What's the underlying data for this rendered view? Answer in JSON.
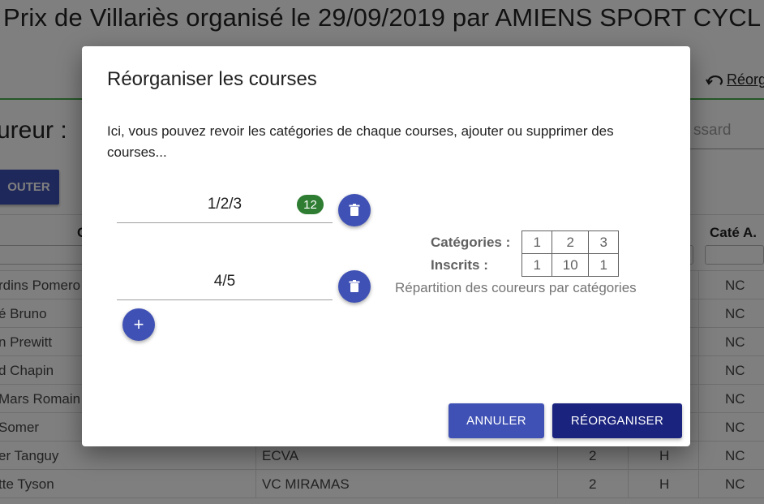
{
  "background": {
    "title": "Prix de Villariès organisé le 29/09/2019 par AMIENS SPORT CYCL",
    "reorganiser_link": "Réorg",
    "coureur_label": "ureur :",
    "dossard_placeholder": "ssard",
    "ajouter_button": "OUTER",
    "table": {
      "headers": {
        "name_partial": "C",
        "cate_a": "Caté A."
      },
      "rows": [
        {
          "name": "rdins Pomero",
          "club": "",
          "cat": "",
          "sex": "",
          "cate_a": "NC"
        },
        {
          "name": "é Bruno",
          "club": "",
          "cat": "",
          "sex": "",
          "cate_a": "NC"
        },
        {
          "name": "n Prewitt",
          "club": "",
          "cat": "",
          "sex": "",
          "cate_a": "NC"
        },
        {
          "name": "d Chapin",
          "club": "",
          "cat": "",
          "sex": "",
          "cate_a": "NC"
        },
        {
          "name": "Mars Romain",
          "club": "",
          "cat": "",
          "sex": "",
          "cate_a": "NC"
        },
        {
          "name": "Somer",
          "club": "",
          "cat": "",
          "sex": "",
          "cate_a": "NC"
        },
        {
          "name": "er Tanguy",
          "club": "ECVA",
          "cat": "2",
          "sex": "H",
          "cate_a": "NC"
        },
        {
          "name": "tte Tyson",
          "club": "VC MIRAMAS",
          "cat": "2",
          "sex": "H",
          "cate_a": "NC"
        }
      ]
    }
  },
  "modal": {
    "title": "Réorganiser les courses",
    "description": "Ici, vous pouvez revoir les catégories de chaque courses, ajouter ou supprimer des courses...",
    "courses": [
      {
        "value": "1/2/3",
        "badge": "12"
      },
      {
        "value": "4/5"
      }
    ],
    "add_icon": "plus-icon",
    "delete_icon": "trash-icon",
    "stats": {
      "categories_label": "Catégories :",
      "inscrits_label": "Inscrits :",
      "categories": [
        "1",
        "2",
        "3"
      ],
      "inscrits": [
        "1",
        "10",
        "1"
      ],
      "caption": "Répartition des coureurs par catégories"
    },
    "buttons": {
      "cancel": "ANNULER",
      "confirm": "RÉORGANISER"
    }
  },
  "colors": {
    "primary": "#3f51b5",
    "primary_dark": "#1a237e",
    "badge_green": "#2e7d32",
    "accent_rule": "#4caf50"
  }
}
